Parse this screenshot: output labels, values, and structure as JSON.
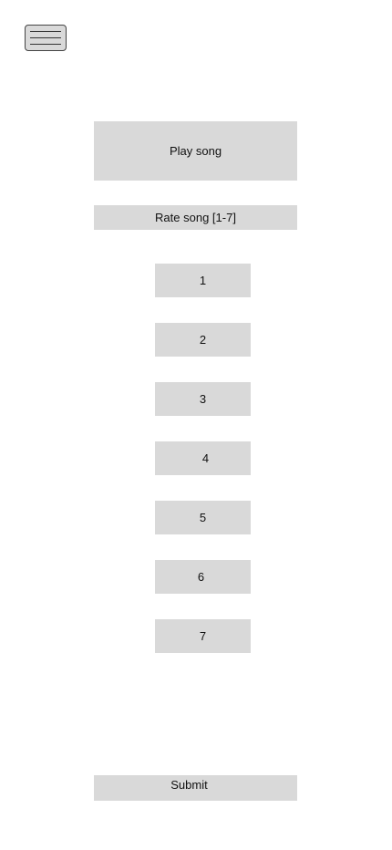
{
  "menu": {
    "icon": "hamburger-menu-icon"
  },
  "player": {
    "play_label": "Play song"
  },
  "rating": {
    "label": "Rate song [1-7]",
    "options": [
      "1",
      "2",
      "3",
      "4",
      "5",
      "6",
      "7"
    ]
  },
  "form": {
    "submit_label": "Submit"
  }
}
